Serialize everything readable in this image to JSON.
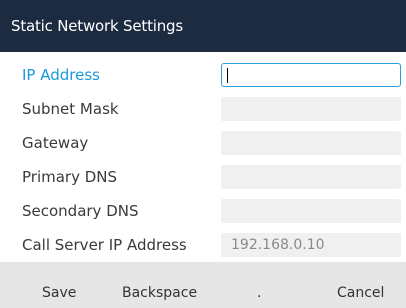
{
  "header": {
    "title": "Static Network Settings"
  },
  "fields": [
    {
      "label": "IP Address",
      "value": "",
      "active": true
    },
    {
      "label": "Subnet Mask",
      "value": ""
    },
    {
      "label": "Gateway",
      "value": ""
    },
    {
      "label": "Primary DNS",
      "value": ""
    },
    {
      "label": "Secondary DNS",
      "value": ""
    },
    {
      "label": "Call Server IP Address",
      "value": "192.168.0.10"
    }
  ],
  "softkeys": {
    "save": "Save",
    "backspace": "Backspace",
    "dot": ".",
    "cancel": "Cancel"
  },
  "colors": {
    "title_bar": "#1c2b40",
    "active_label": "#1a9ad6",
    "softkey_bar": "#e6e6e6"
  }
}
